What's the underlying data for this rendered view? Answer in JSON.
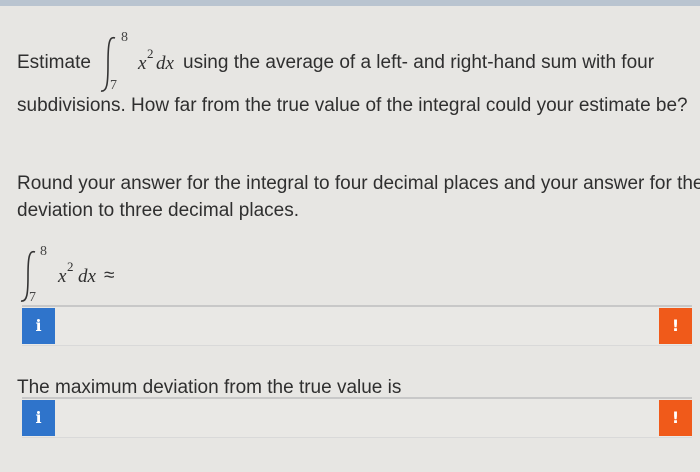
{
  "question": {
    "estimate_word": "Estimate",
    "integral": {
      "upper": "8",
      "lower": "7",
      "base": "x",
      "exponent": "2",
      "dx": "dx"
    },
    "line1_rest": "using the average of a left- and right-hand sum with four",
    "line2": "subdivisions. How far from the true value of the integral could your estimate be?",
    "instructions_line1": "Round your answer for the integral to four decimal places and your answer for the",
    "instructions_line2": "deviation to three decimal places."
  },
  "answer1": {
    "integral": {
      "upper": "8",
      "lower": "7",
      "base": "x",
      "exponent": "2",
      "dx": "dx",
      "approx": "≈"
    },
    "value": "",
    "info_icon": "i",
    "alert_icon": "!"
  },
  "answer2": {
    "label": "The maximum deviation from the true value is",
    "value": "",
    "info_icon": "i",
    "alert_icon": "!"
  },
  "colors": {
    "info": "#2f74cb",
    "alert": "#f05a1a",
    "background": "#e7e6e3"
  },
  "icons": {
    "info": "info-icon",
    "alert": "exclamation-icon"
  }
}
